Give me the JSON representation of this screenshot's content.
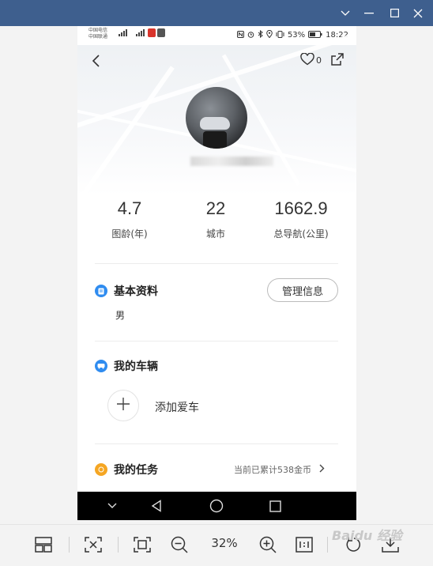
{
  "window": {
    "buttons": [
      "chevron-down-icon",
      "minimize-icon",
      "maximize-icon",
      "close-icon"
    ]
  },
  "status_bar": {
    "carrier_1": "中国电信",
    "carrier_2": "中国联通",
    "battery": "53%",
    "time": "18:22"
  },
  "profile": {
    "like_count": "0",
    "stats": [
      {
        "value": "4.7",
        "label": "图龄(年)"
      },
      {
        "value": "22",
        "label": "城市"
      },
      {
        "value": "1662.9",
        "label": "总导航(公里)"
      }
    ]
  },
  "basic_info": {
    "title": "基本资料",
    "manage_label": "管理信息",
    "gender": "男"
  },
  "vehicles": {
    "title": "我的车辆",
    "add_label": "添加爱车"
  },
  "tasks": {
    "title": "我的任务",
    "summary": "当前已累计538金币"
  },
  "toolbar": {
    "zoom_level": "32%"
  },
  "watermark": {
    "text": "Baidu 经验"
  },
  "colors": {
    "title_bar": "#3e5f8e",
    "info_icon": "#2f8cf0",
    "vehicle_icon": "#2f8cf0",
    "task_icon": "#f5a623"
  }
}
